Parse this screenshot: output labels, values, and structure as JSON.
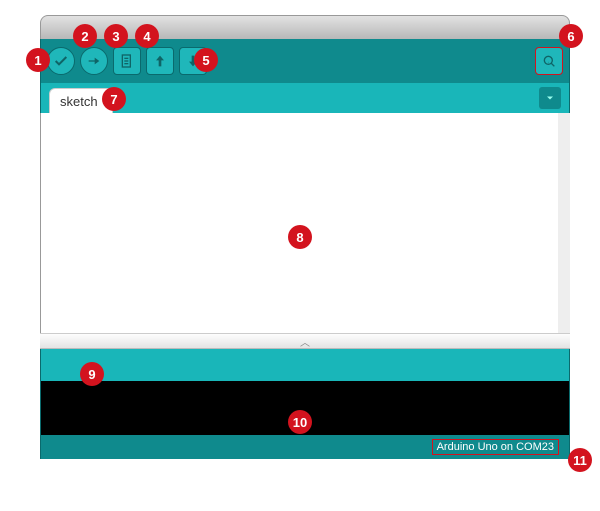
{
  "tab": {
    "label": "sketch"
  },
  "footer": {
    "board": "Arduino Uno on COM23"
  },
  "icons": {
    "verify": "verify-icon",
    "upload": "upload-icon",
    "new": "new-file-icon",
    "open": "open-file-icon",
    "save": "save-file-icon",
    "serial": "serial-monitor-icon",
    "tabmenu": "dropdown-icon"
  },
  "callouts": {
    "c1": "1",
    "c2": "2",
    "c3": "3",
    "c4": "4",
    "c5": "5",
    "c6": "6",
    "c7": "7",
    "c8": "8",
    "c9": "9",
    "c10": "10",
    "c11": "11"
  }
}
